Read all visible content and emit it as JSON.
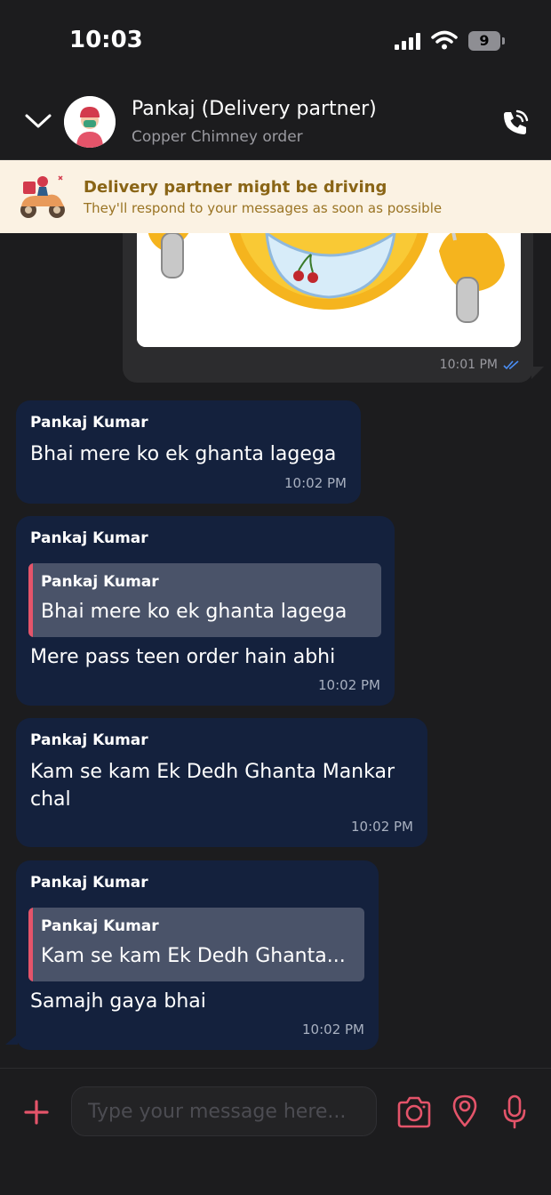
{
  "status_bar": {
    "time": "10:03",
    "battery": "9"
  },
  "header": {
    "name": "Pankaj (Delivery partner)",
    "subtitle": "Copper Chimney order"
  },
  "banner": {
    "title": "Delivery partner might be driving",
    "subtitle": "They'll respond to your messages as soon as possible"
  },
  "sticker_message": {
    "time": "10:01 PM",
    "status": "read"
  },
  "messages": [
    {
      "sender": "Pankaj Kumar",
      "text": "Bhai mere ko ek ghanta lagega",
      "time": "10:02 PM"
    },
    {
      "sender": "Pankaj Kumar",
      "quote_sender": "Pankaj Kumar",
      "quote_text": "Bhai mere ko ek ghanta lagega",
      "text": "Mere pass teen order hain abhi",
      "time": "10:02 PM"
    },
    {
      "sender": "Pankaj Kumar",
      "text_line1": "Kam se kam Ek Dedh Ghanta Mankar",
      "text_line2": "chal",
      "time": "10:02 PM"
    },
    {
      "sender": "Pankaj Kumar",
      "quote_sender": "Pankaj Kumar",
      "quote_text": "Kam se kam Ek Dedh Ghanta...",
      "text": "Samajh gaya bhai",
      "time": "10:02 PM"
    }
  ],
  "input": {
    "placeholder": "Type your message here..."
  },
  "icons": {
    "back": "chevron-down-icon",
    "call": "phone-call-icon",
    "banner": "scooter-icon",
    "add": "plus-icon",
    "camera": "camera-icon",
    "location": "location-pin-icon",
    "mic": "microphone-icon"
  },
  "colors": {
    "accent": "#e4546a",
    "bubble_incoming": "#14213d",
    "bubble_outgoing": "#2c2c2e",
    "banner_bg": "#fbf2e3",
    "banner_text": "#8a6516"
  }
}
